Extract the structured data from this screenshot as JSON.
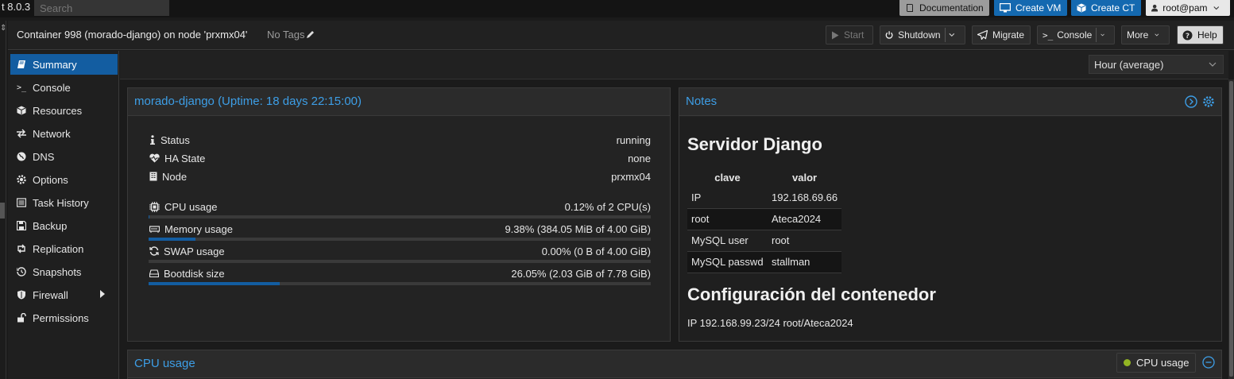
{
  "topbar": {
    "version": "t 8.0.3",
    "search_placeholder": "Search",
    "documentation": "Documentation",
    "create_vm": "Create VM",
    "create_ct": "Create CT",
    "user": "root@pam"
  },
  "header": {
    "title": "Container 998 (morado-django) on node 'prxmx04'",
    "tags": "No Tags",
    "start": "Start",
    "shutdown": "Shutdown",
    "migrate": "Migrate",
    "console": "Console",
    "more": "More",
    "help": "Help"
  },
  "sidebar": {
    "items": [
      {
        "label": "Summary",
        "icon": "book-icon"
      },
      {
        "label": "Console",
        "icon": "terminal-icon"
      },
      {
        "label": "Resources",
        "icon": "cube-icon"
      },
      {
        "label": "Network",
        "icon": "exchange-icon"
      },
      {
        "label": "DNS",
        "icon": "globe-icon"
      },
      {
        "label": "Options",
        "icon": "gear-icon"
      },
      {
        "label": "Task History",
        "icon": "list-icon"
      },
      {
        "label": "Backup",
        "icon": "floppy-icon"
      },
      {
        "label": "Replication",
        "icon": "retweet-icon"
      },
      {
        "label": "Snapshots",
        "icon": "history-icon"
      },
      {
        "label": "Firewall",
        "icon": "shield-icon"
      },
      {
        "label": "Permissions",
        "icon": "unlock-icon"
      }
    ]
  },
  "timeframe": "Hour (average)",
  "summary": {
    "title": "morado-django (Uptime: 18 days 22:15:00)",
    "rows": [
      {
        "label": "Status",
        "value": "running"
      },
      {
        "label": "HA State",
        "value": "none"
      },
      {
        "label": "Node",
        "value": "prxmx04"
      },
      {
        "label": "CPU usage",
        "value": "0.12% of 2 CPU(s)",
        "fraction": 0.0012
      },
      {
        "label": "Memory usage",
        "value": "9.38% (384.05 MiB of 4.00 GiB)",
        "fraction": 0.0938
      },
      {
        "label": "SWAP usage",
        "value": "0.00% (0 B of 4.00 GiB)",
        "fraction": 0.0
      },
      {
        "label": "Bootdisk size",
        "value": "26.05% (2.03 GiB of 7.78 GiB)",
        "fraction": 0.2605
      }
    ]
  },
  "notes": {
    "title": "Notes",
    "heading1": "Servidor Django",
    "table_headers": [
      "clave",
      "valor"
    ],
    "table_rows": [
      [
        "IP",
        "192.168.69.66"
      ],
      [
        "root",
        "Ateca2024"
      ],
      [
        "MySQL user",
        "root"
      ],
      [
        "MySQL passwd",
        "stallman"
      ]
    ],
    "heading2": "Configuración del contenedor",
    "line1": "IP 192.168.99.23/24 root/Ateca2024"
  },
  "cpu_panel": {
    "title": "CPU usage",
    "legend": "CPU usage"
  },
  "colors": {
    "accent": "#135da1",
    "link": "#3d9ee6",
    "legend_dot": "#93b523"
  }
}
